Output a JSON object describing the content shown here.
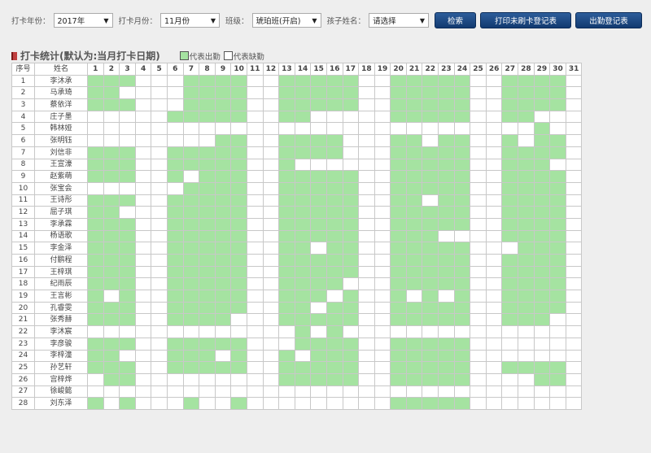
{
  "filters": {
    "year_label": "打卡年份：",
    "year_value": "2017年",
    "month_label": "打卡月份：",
    "month_value": "11月份",
    "class_label": "班级：",
    "class_value": "琥珀班(开启)",
    "child_label": "孩子姓名：",
    "child_value": "请选择",
    "search_button": "检索",
    "print_unswiped_button": "打印未刷卡登记表",
    "attendance_register_button": "出勤登记表"
  },
  "section": {
    "title": "打卡统计(默认为:当月打卡日期)",
    "legend_present": "代表出勤",
    "legend_absent": "代表缺勤",
    "present_color": "#a5e3a1",
    "absent_color": "#ffffff"
  },
  "table": {
    "col_index": "序号",
    "col_name": "姓名",
    "days": [
      "1",
      "2",
      "3",
      "4",
      "5",
      "6",
      "7",
      "8",
      "9",
      "10",
      "11",
      "12",
      "13",
      "14",
      "15",
      "16",
      "17",
      "18",
      "19",
      "20",
      "21",
      "22",
      "23",
      "24",
      "25",
      "26",
      "27",
      "28",
      "29",
      "30",
      "31"
    ],
    "rows": [
      {
        "index": "1",
        "name": "李沐承",
        "present": [
          1,
          2,
          3,
          7,
          8,
          9,
          10,
          13,
          14,
          15,
          16,
          17,
          20,
          21,
          22,
          23,
          24,
          27,
          28,
          29,
          30
        ]
      },
      {
        "index": "2",
        "name": "马承琦",
        "present": [
          1,
          2,
          7,
          8,
          9,
          10,
          13,
          14,
          15,
          16,
          17,
          20,
          21,
          22,
          23,
          24,
          27,
          28,
          29,
          30
        ]
      },
      {
        "index": "3",
        "name": "蔡依洋",
        "present": [
          1,
          2,
          3,
          7,
          8,
          9,
          10,
          13,
          14,
          15,
          16,
          17,
          20,
          21,
          22,
          23,
          24,
          27,
          28,
          29,
          30
        ]
      },
      {
        "index": "4",
        "name": "庄子墨",
        "present": [
          6,
          7,
          8,
          9,
          10,
          13,
          14,
          20,
          21,
          22,
          23,
          24,
          27,
          28
        ]
      },
      {
        "index": "5",
        "name": "韩林娅",
        "present": [
          29
        ]
      },
      {
        "index": "6",
        "name": "张明钰",
        "present": [
          9,
          10,
          13,
          14,
          15,
          16,
          20,
          21,
          23,
          24,
          27,
          29,
          30
        ]
      },
      {
        "index": "7",
        "name": "刘信非",
        "present": [
          1,
          2,
          3,
          6,
          7,
          8,
          9,
          10,
          13,
          14,
          15,
          16,
          20,
          21,
          22,
          23,
          24,
          27,
          28,
          29,
          30
        ]
      },
      {
        "index": "8",
        "name": "王宣濠",
        "present": [
          1,
          2,
          3,
          6,
          7,
          8,
          9,
          10,
          13,
          20,
          21,
          22,
          23,
          24,
          27,
          28,
          29
        ]
      },
      {
        "index": "9",
        "name": "赵紫萌",
        "present": [
          1,
          2,
          3,
          6,
          8,
          9,
          10,
          13,
          14,
          15,
          16,
          17,
          20,
          21,
          22,
          23,
          24,
          27,
          28,
          29,
          30
        ]
      },
      {
        "index": "10",
        "name": "张宝会",
        "present": [
          7,
          8,
          9,
          10,
          13,
          14,
          15,
          16,
          17,
          20,
          21,
          22,
          23,
          24,
          27,
          28,
          29,
          30
        ]
      },
      {
        "index": "11",
        "name": "王诗彤",
        "present": [
          1,
          2,
          3,
          6,
          7,
          8,
          9,
          10,
          13,
          14,
          15,
          16,
          17,
          20,
          21,
          23,
          24,
          27,
          28,
          29,
          30
        ]
      },
      {
        "index": "12",
        "name": "屈子琪",
        "present": [
          1,
          2,
          6,
          7,
          8,
          9,
          10,
          13,
          14,
          15,
          16,
          17,
          20,
          21,
          22,
          23,
          24,
          27,
          28,
          29,
          30
        ]
      },
      {
        "index": "13",
        "name": "李承霖",
        "present": [
          1,
          2,
          3,
          6,
          7,
          8,
          9,
          10,
          13,
          14,
          15,
          16,
          17,
          20,
          21,
          22,
          23,
          24,
          27,
          28,
          29,
          30
        ]
      },
      {
        "index": "14",
        "name": "杨语歌",
        "present": [
          1,
          2,
          3,
          6,
          7,
          8,
          9,
          10,
          13,
          14,
          15,
          16,
          17,
          20,
          21,
          22,
          27,
          28,
          29,
          30
        ]
      },
      {
        "index": "15",
        "name": "李金泽",
        "present": [
          1,
          2,
          3,
          6,
          7,
          8,
          9,
          10,
          13,
          14,
          16,
          17,
          20,
          21,
          22,
          23,
          24,
          28,
          29,
          30
        ]
      },
      {
        "index": "16",
        "name": "付鹏程",
        "present": [
          1,
          2,
          3,
          6,
          7,
          8,
          9,
          10,
          13,
          14,
          15,
          16,
          17,
          20,
          21,
          22,
          23,
          24,
          27,
          28,
          29,
          30
        ]
      },
      {
        "index": "17",
        "name": "王梓琪",
        "present": [
          1,
          2,
          3,
          6,
          7,
          8,
          9,
          10,
          13,
          14,
          15,
          16,
          17,
          20,
          21,
          22,
          23,
          24,
          27,
          28,
          29,
          30
        ]
      },
      {
        "index": "18",
        "name": "纪雨辰",
        "present": [
          1,
          2,
          3,
          6,
          7,
          8,
          9,
          10,
          13,
          14,
          15,
          16,
          20,
          21,
          22,
          23,
          24,
          27,
          28,
          29,
          30
        ]
      },
      {
        "index": "19",
        "name": "王言彬",
        "present": [
          1,
          3,
          6,
          7,
          8,
          9,
          10,
          13,
          14,
          15,
          17,
          20,
          22,
          24,
          27,
          28,
          29,
          30
        ]
      },
      {
        "index": "20",
        "name": "孔睿雯",
        "present": [
          1,
          2,
          3,
          6,
          7,
          8,
          9,
          10,
          13,
          14,
          16,
          17,
          20,
          21,
          22,
          23,
          24,
          27,
          28,
          29,
          30
        ]
      },
      {
        "index": "21",
        "name": "张秀赫",
        "present": [
          1,
          2,
          3,
          6,
          7,
          8,
          9,
          13,
          14,
          15,
          16,
          17,
          20,
          21,
          22,
          23,
          24,
          27,
          28,
          29
        ]
      },
      {
        "index": "22",
        "name": "李沐宸",
        "present": [
          14,
          16
        ]
      },
      {
        "index": "23",
        "name": "李彦骏",
        "present": [
          1,
          2,
          3,
          6,
          7,
          8,
          9,
          10,
          14,
          15,
          16,
          17,
          20,
          21,
          22,
          23,
          24
        ]
      },
      {
        "index": "24",
        "name": "李梓潼",
        "present": [
          1,
          2,
          6,
          7,
          8,
          10,
          13,
          15,
          16,
          17,
          20,
          21,
          22,
          23,
          24
        ]
      },
      {
        "index": "25",
        "name": "孙艺轩",
        "present": [
          1,
          2,
          3,
          6,
          7,
          8,
          9,
          10,
          13,
          14,
          15,
          16,
          17,
          20,
          21,
          22,
          23,
          24,
          27,
          28,
          29,
          30
        ]
      },
      {
        "index": "26",
        "name": "宫梓烨",
        "present": [
          2,
          3,
          13,
          14,
          15,
          16,
          17,
          20,
          21,
          22,
          23,
          24,
          29,
          30
        ]
      },
      {
        "index": "27",
        "name": "徐峻懿",
        "present": []
      },
      {
        "index": "28",
        "name": "刘东泽",
        "present": [
          1,
          3,
          7,
          10,
          20,
          21,
          22,
          23,
          24
        ]
      }
    ]
  }
}
